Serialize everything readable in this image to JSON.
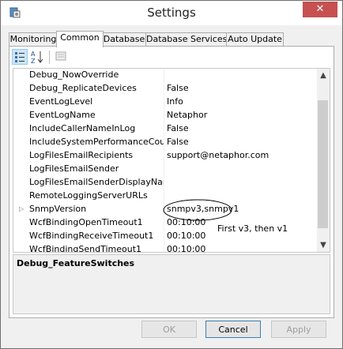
{
  "window": {
    "title": "Settings",
    "close_glyph": "✕"
  },
  "tabs": [
    {
      "label": "Monitoring",
      "active": false
    },
    {
      "label": "Common",
      "active": true
    },
    {
      "label": "Database",
      "active": false
    },
    {
      "label": "Database Services",
      "active": false
    },
    {
      "label": "Auto Update",
      "active": false
    }
  ],
  "toolbar": {
    "icons": [
      "categorized-icon",
      "alphabetical-icon",
      "property-pages-icon"
    ]
  },
  "properties": [
    {
      "name": "Debug_NowOverride",
      "value": ""
    },
    {
      "name": "Debug_ReplicateDevices",
      "value": "False"
    },
    {
      "name": "EventLogLevel",
      "value": "Info"
    },
    {
      "name": "EventLogName",
      "value": "Netaphor"
    },
    {
      "name": "IncludeCallerNameInLog",
      "value": "False"
    },
    {
      "name": "IncludeSystemPerformanceCount",
      "value": "False"
    },
    {
      "name": "LogFilesEmailRecipients",
      "value": "support@netaphor.com"
    },
    {
      "name": "LogFilesEmailSender",
      "value": ""
    },
    {
      "name": "LogFilesEmailSenderDisplayName",
      "value": ""
    },
    {
      "name": "RemoteLoggingServerURLs",
      "value": ""
    },
    {
      "name": "SnmpVersion",
      "value": "snmpv3,snmpv1",
      "expandable": true
    },
    {
      "name": "WcfBindingOpenTimeout1",
      "value": "00:10:00"
    },
    {
      "name": "WcfBindingReceiveTimeout1",
      "value": "00:10:00"
    },
    {
      "name": "WcfBindingSendTimeout1",
      "value": "00:10:00"
    }
  ],
  "description": {
    "title": "Debug_FeatureSwitches"
  },
  "annotation": {
    "text": "First v3, then v1"
  },
  "buttons": {
    "ok": "OK",
    "cancel": "Cancel",
    "apply": "Apply"
  },
  "colors": {
    "close": "#c75050",
    "accent": "#3c7fb1",
    "selection": "#cce4f7"
  }
}
